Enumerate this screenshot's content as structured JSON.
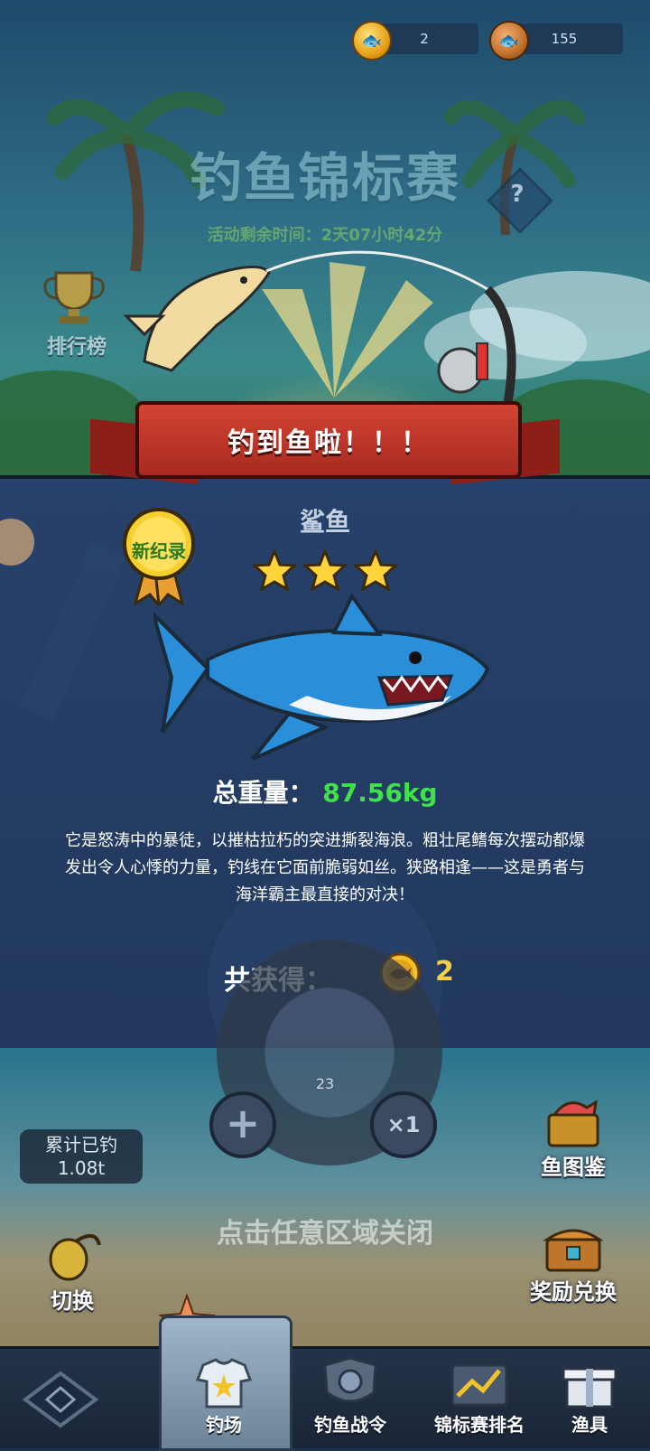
{
  "currency": {
    "gold_coins": "2",
    "bronze_coins": "155"
  },
  "event": {
    "title": "钓鱼锦标赛",
    "timer": "活动剩余时间：2天07小时42分",
    "help": "?"
  },
  "sidebar": {
    "leaderboard_label": "排行榜"
  },
  "catch": {
    "banner": "钓到鱼啦！！！",
    "fish_name": "鲨鱼",
    "stars": 3,
    "new_record_badge": "新纪录",
    "weight_label": "总重量：",
    "weight_value": "87.56kg",
    "description": "它是怒涛中的暴徒，以摧枯拉朽的突进撕裂海浪。粗壮尾鳍每次摆动都爆发出令人心悸的力量，钓线在它面前脆弱如丝。狭路相逢——这是勇者与海洋霸主最直接的对决！",
    "reward_label": "共获得：",
    "reward_value": "2"
  },
  "game_ui": {
    "reel_count": "23",
    "plus_button": "+",
    "multiplier_button": "×1",
    "total_caught_label": "累计已钓",
    "total_caught_value": "1.08t",
    "close_hint": "点击任意区域关闭",
    "fish_guide_label": "鱼图鉴",
    "reward_exchange_label": "奖励兑换",
    "switch_label": "切换"
  },
  "nav": {
    "tabs": [
      {
        "label": "钓场"
      },
      {
        "label": "钓鱼战令"
      },
      {
        "label": "锦标赛排名"
      },
      {
        "label": "渔具"
      }
    ],
    "active_index": 0
  },
  "colors": {
    "weight_value": "#3fe24a",
    "reward_value": "#f2d04a",
    "banner": "#c23a2c"
  }
}
